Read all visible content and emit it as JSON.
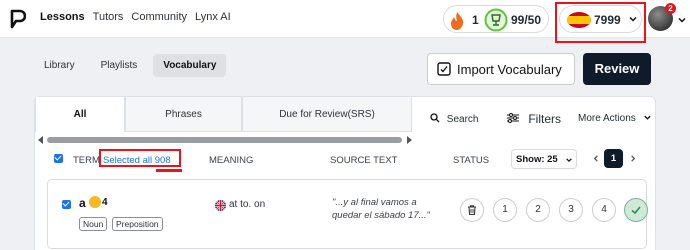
{
  "nav": {
    "links": [
      "Lessons",
      "Tutors",
      "Community",
      "Lynx AI"
    ],
    "active_link": "Lessons",
    "streak": "1",
    "goal": "99/50",
    "coins": "7999",
    "notifications": "2"
  },
  "subtabs": [
    "Library",
    "Playlists",
    "Vocabulary"
  ],
  "active_subtab": "Vocabulary",
  "actions": {
    "import_label": "Import Vocabulary",
    "review_label": "Review"
  },
  "tabs": [
    "All",
    "Phrases",
    "Due for Review(SRS)"
  ],
  "tools": {
    "search_label": "Search",
    "filters_label": "Filters",
    "more_label": "More Actions"
  },
  "table": {
    "headers": {
      "term": "TERM",
      "selected": "Selected all 908",
      "meaning": "MEANING",
      "source": "SOURCE TEXT",
      "status": "STATUS"
    },
    "show_label": "Show: 25",
    "page": "1"
  },
  "row": {
    "term": "a",
    "count": "4",
    "tags": [
      "Noun",
      "Preposition"
    ],
    "meaning": "at to. on",
    "source": "\"...y al final vamos a quedar el sábado 17...\"",
    "levels": [
      "1",
      "2",
      "3",
      "4"
    ]
  },
  "colors": {
    "accent": "#1a73e8",
    "primary_dark": "#0f1a2b",
    "highlight_red": "#e8131b",
    "flame": "#f26b1d",
    "goal_green": "#5ec43a"
  }
}
